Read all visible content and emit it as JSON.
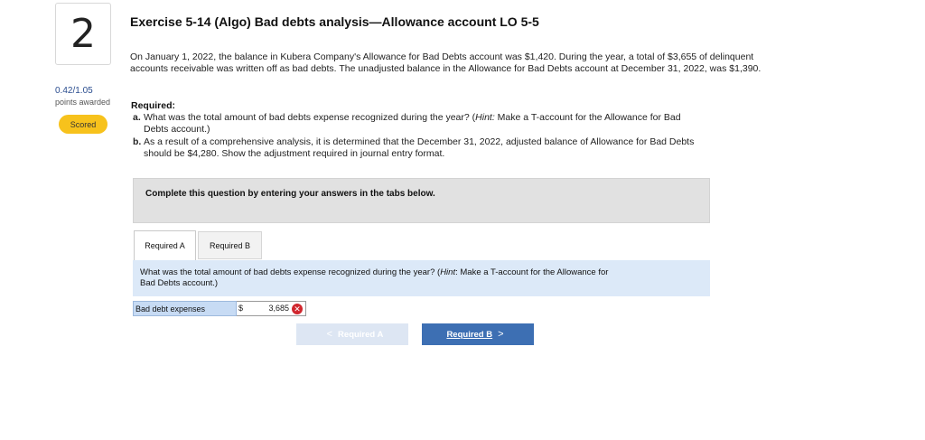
{
  "question": {
    "number": "2",
    "points": "0.42/1.05",
    "points_label": "points awarded",
    "status_badge": "Scored"
  },
  "exercise": {
    "title": "Exercise 5-14 (Algo) Bad debts analysis—Allowance account LO 5-5",
    "paragraph": "On January 1, 2022, the balance in Kubera Company's Allowance for Bad Debts account was $1,420. During the year, a total of $3,655 of delinquent accounts receivable was written off as bad debts. The unadjusted balance in the Allowance for Bad Debts account at December 31, 2022, was $1,390.",
    "required_heading": "Required:",
    "req_a_label": "a.",
    "req_a_line1": "What was the total amount of bad debts expense recognized during the year? (",
    "req_a_hint_word": "Hint:",
    "req_a_line1b": " Make a T-account for the Allowance for Bad",
    "req_a_line2": "Debts account.)",
    "req_b_label": "b.",
    "req_b_line1": "As a result of a comprehensive analysis, it is determined that the December 31, 2022, adjusted balance of Allowance for Bad Debts",
    "req_b_line2": "should be $4,280. Show the adjustment required in journal entry format."
  },
  "instructions": "Complete this question by entering your answers in the tabs below.",
  "tabs": [
    {
      "label": "Required A",
      "active": true
    },
    {
      "label": "Required B",
      "active": false
    }
  ],
  "panel": {
    "question_pre": "What was the total amount of bad debts expense recognized during the year? (",
    "question_hint": "Hint",
    "question_post": ": Make a T-account for the Allowance for",
    "question_line2": "Bad Debts account.)"
  },
  "answer": {
    "label": "Bad debt expenses",
    "currency": "$",
    "value": "3,685",
    "status": "incorrect"
  },
  "nav": {
    "prev_label": "Required A",
    "next_label": "Required B",
    "prev_chevron": "<",
    "next_chevron": ">"
  },
  "colors": {
    "badge": "#f7c21c",
    "panel_bg": "#dce9f8",
    "next_button": "#3d6fb3",
    "error": "#d0262d"
  }
}
